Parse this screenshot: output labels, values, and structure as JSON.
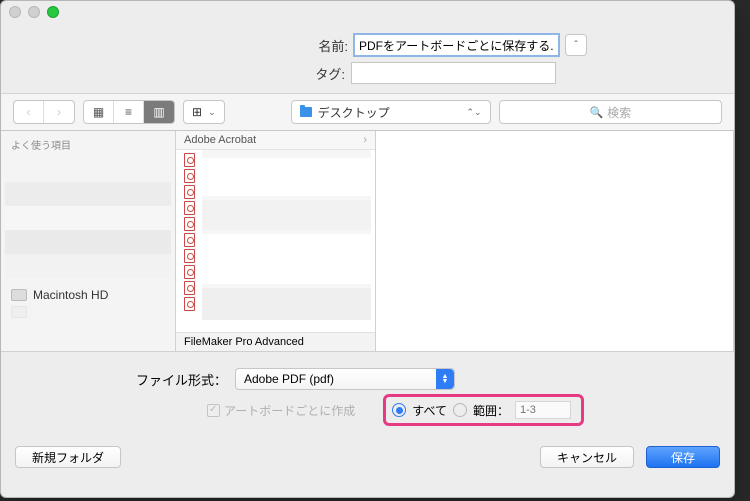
{
  "labels": {
    "name": "名前:",
    "tags": "タグ:",
    "file_format": "ファイル形式：",
    "per_artboard": "アートボードごとに作成",
    "all": "すべて",
    "range": "範囲："
  },
  "values": {
    "filename": "PDFをアートボードごとに保存する.pdf",
    "tags": "",
    "location": "デスクトップ",
    "search_placeholder": "検索",
    "format": "Adobe PDF (pdf)",
    "range_placeholder": "1-3"
  },
  "sidebar": {
    "favorites": "よく使う項目",
    "macintosh": "Macintosh HD"
  },
  "column1": {
    "header": "Adobe Acrobat",
    "footer": "FileMaker Pro Advanced"
  },
  "buttons": {
    "new_folder": "新規フォルダ",
    "cancel": "キャンセル",
    "save": "保存"
  }
}
